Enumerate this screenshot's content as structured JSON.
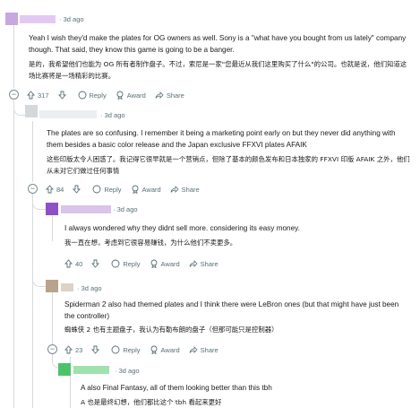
{
  "comments": [
    {
      "time": "3d ago",
      "en": "Yeah I wish they'd make the plates for OG owners as well. Sony is a \"what have you bought from us lately\" company though. That said, they know this game is going to be a banger.",
      "zh": "是的，我希望他们也能为 OG 所有者制作盘子。不过，索尼是一家\"您最近从我们这里购买了什么\"的公司。也就是说，他们知道这场比赛将是一场精彩的比赛。",
      "votes": "317",
      "reply": "Reply",
      "award": "Award",
      "share": "Share",
      "colors": [
        "#c9a6e0",
        "#e3c9f2"
      ]
    },
    {
      "time": "3d ago",
      "en": "The plates are so confusing. I remember it being a marketing point early on but they never did anything with them besides a basic color release and the Japan exclusive FFXVI plates AFAIK",
      "zh": "这些印版太令人困惑了。我记得它很早就是一个营销点，但除了基本的颜色发布和日本独家的 FFXVI 印版 AFAIK 之外，他们从未对它们做过任何事情",
      "votes": "84",
      "reply": "Reply",
      "award": "Award",
      "share": "Share",
      "colors": [
        "#d5d8da",
        "#eceeef"
      ]
    },
    {
      "time": "3d ago",
      "en": "I always wondered why they didnt sell more. considering its easy money.",
      "zh": "我一直在想，考虑到它很容易赚钱，为什么他们不卖更多。",
      "votes": "40",
      "reply": "Reply",
      "award": "Award",
      "share": "Share",
      "colors": [
        "#8e4fc7",
        "#d9c4ec"
      ]
    },
    {
      "time": "3d ago",
      "en": "Spiderman 2 also had themed plates and I think there were LeBron ones (but that might have just been the controller)",
      "zh": "蜘蛛侠 2 也有主题盘子，我认为有勒布朗的盘子（但那可能只是控制器）",
      "votes": "23",
      "reply": "Reply",
      "award": "Award",
      "share": "Share",
      "colors": [
        "#b8a48c",
        "#dcd2c6"
      ]
    },
    {
      "time": "3d ago",
      "en": "A also Final Fantasy, all of them looking better than this tbh",
      "zh": "A 也是最终幻想，他们都比这个 tbh 看起来更好",
      "colors": [
        "#4cc36a",
        "#9fe2ae"
      ]
    }
  ]
}
